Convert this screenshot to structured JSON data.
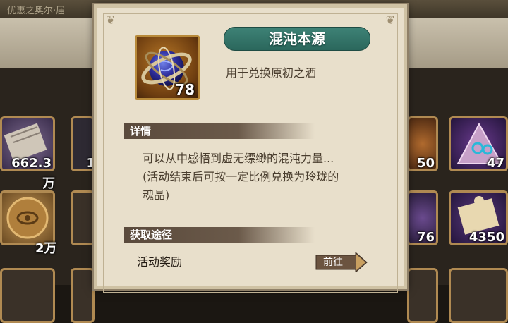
{
  "background": {
    "top_text": "优惠之奥尔·届",
    "slots_left": [
      {
        "count": "662.3",
        "below": "万"
      },
      {
        "count": "",
        "below": "2万"
      }
    ],
    "slots_partial_left": [
      {
        "count": "1"
      }
    ],
    "slots_right": [
      {
        "count": "50"
      },
      {
        "count": "76"
      }
    ],
    "slots_far_right": [
      {
        "count": "47"
      },
      {
        "count": "4350"
      }
    ]
  },
  "item": {
    "name": "混沌本源",
    "count": "78",
    "subtitle": "用于兑换原初之酒",
    "icon": "chaos-orb-icon"
  },
  "details": {
    "header": "详情",
    "text_line1": "可以从中感悟到虚无缥缈的混沌力量...",
    "text_line2": "(活动结束后可按一定比例兑换为玲珑的",
    "text_line3": "魂晶)"
  },
  "sources": {
    "header": "获取途径",
    "items": [
      {
        "label": "活动奖励",
        "button": "前往"
      }
    ]
  },
  "colors": {
    "parchment": "#e8dfcb",
    "title_banner": "#2f6d62",
    "section_bar": "#5a4a3c",
    "text": "#4a3e2f"
  }
}
